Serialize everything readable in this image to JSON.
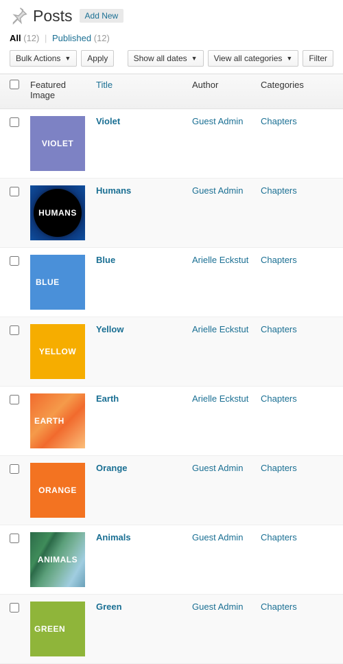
{
  "header": {
    "title": "Posts",
    "add_new": "Add New"
  },
  "subsub": {
    "all_label": "All",
    "all_count": "(12)",
    "published_label": "Published",
    "published_count": "(12)"
  },
  "controls": {
    "bulk_actions": "Bulk Actions",
    "apply": "Apply",
    "show_dates": "Show all dates",
    "view_categories": "View all categories",
    "filter": "Filter"
  },
  "columns": {
    "featured": "Featured Image",
    "title": "Title",
    "author": "Author",
    "categories": "Categories"
  },
  "rows": [
    {
      "title": "Violet",
      "author": "Guest Admin",
      "category": "Chapters",
      "thumb_class": "thumb-violet",
      "thumb_text": "VIOLET"
    },
    {
      "title": "Humans",
      "author": "Guest Admin",
      "category": "Chapters",
      "thumb_class": "thumb-humans",
      "thumb_text": "HUMANS"
    },
    {
      "title": "Blue",
      "author": "Arielle Eckstut",
      "category": "Chapters",
      "thumb_class": "thumb-blue",
      "thumb_text": "BLUE"
    },
    {
      "title": "Yellow",
      "author": "Arielle Eckstut",
      "category": "Chapters",
      "thumb_class": "thumb-yellow",
      "thumb_text": "YELLOW"
    },
    {
      "title": "Earth",
      "author": "Arielle Eckstut",
      "category": "Chapters",
      "thumb_class": "thumb-earth",
      "thumb_text": "EARTH"
    },
    {
      "title": "Orange",
      "author": "Guest Admin",
      "category": "Chapters",
      "thumb_class": "thumb-orange",
      "thumb_text": "ORANGE"
    },
    {
      "title": "Animals",
      "author": "Guest Admin",
      "category": "Chapters",
      "thumb_class": "thumb-animals",
      "thumb_text": "ANIMALS"
    },
    {
      "title": "Green",
      "author": "Guest Admin",
      "category": "Chapters",
      "thumb_class": "thumb-green",
      "thumb_text": "GREEN"
    }
  ]
}
